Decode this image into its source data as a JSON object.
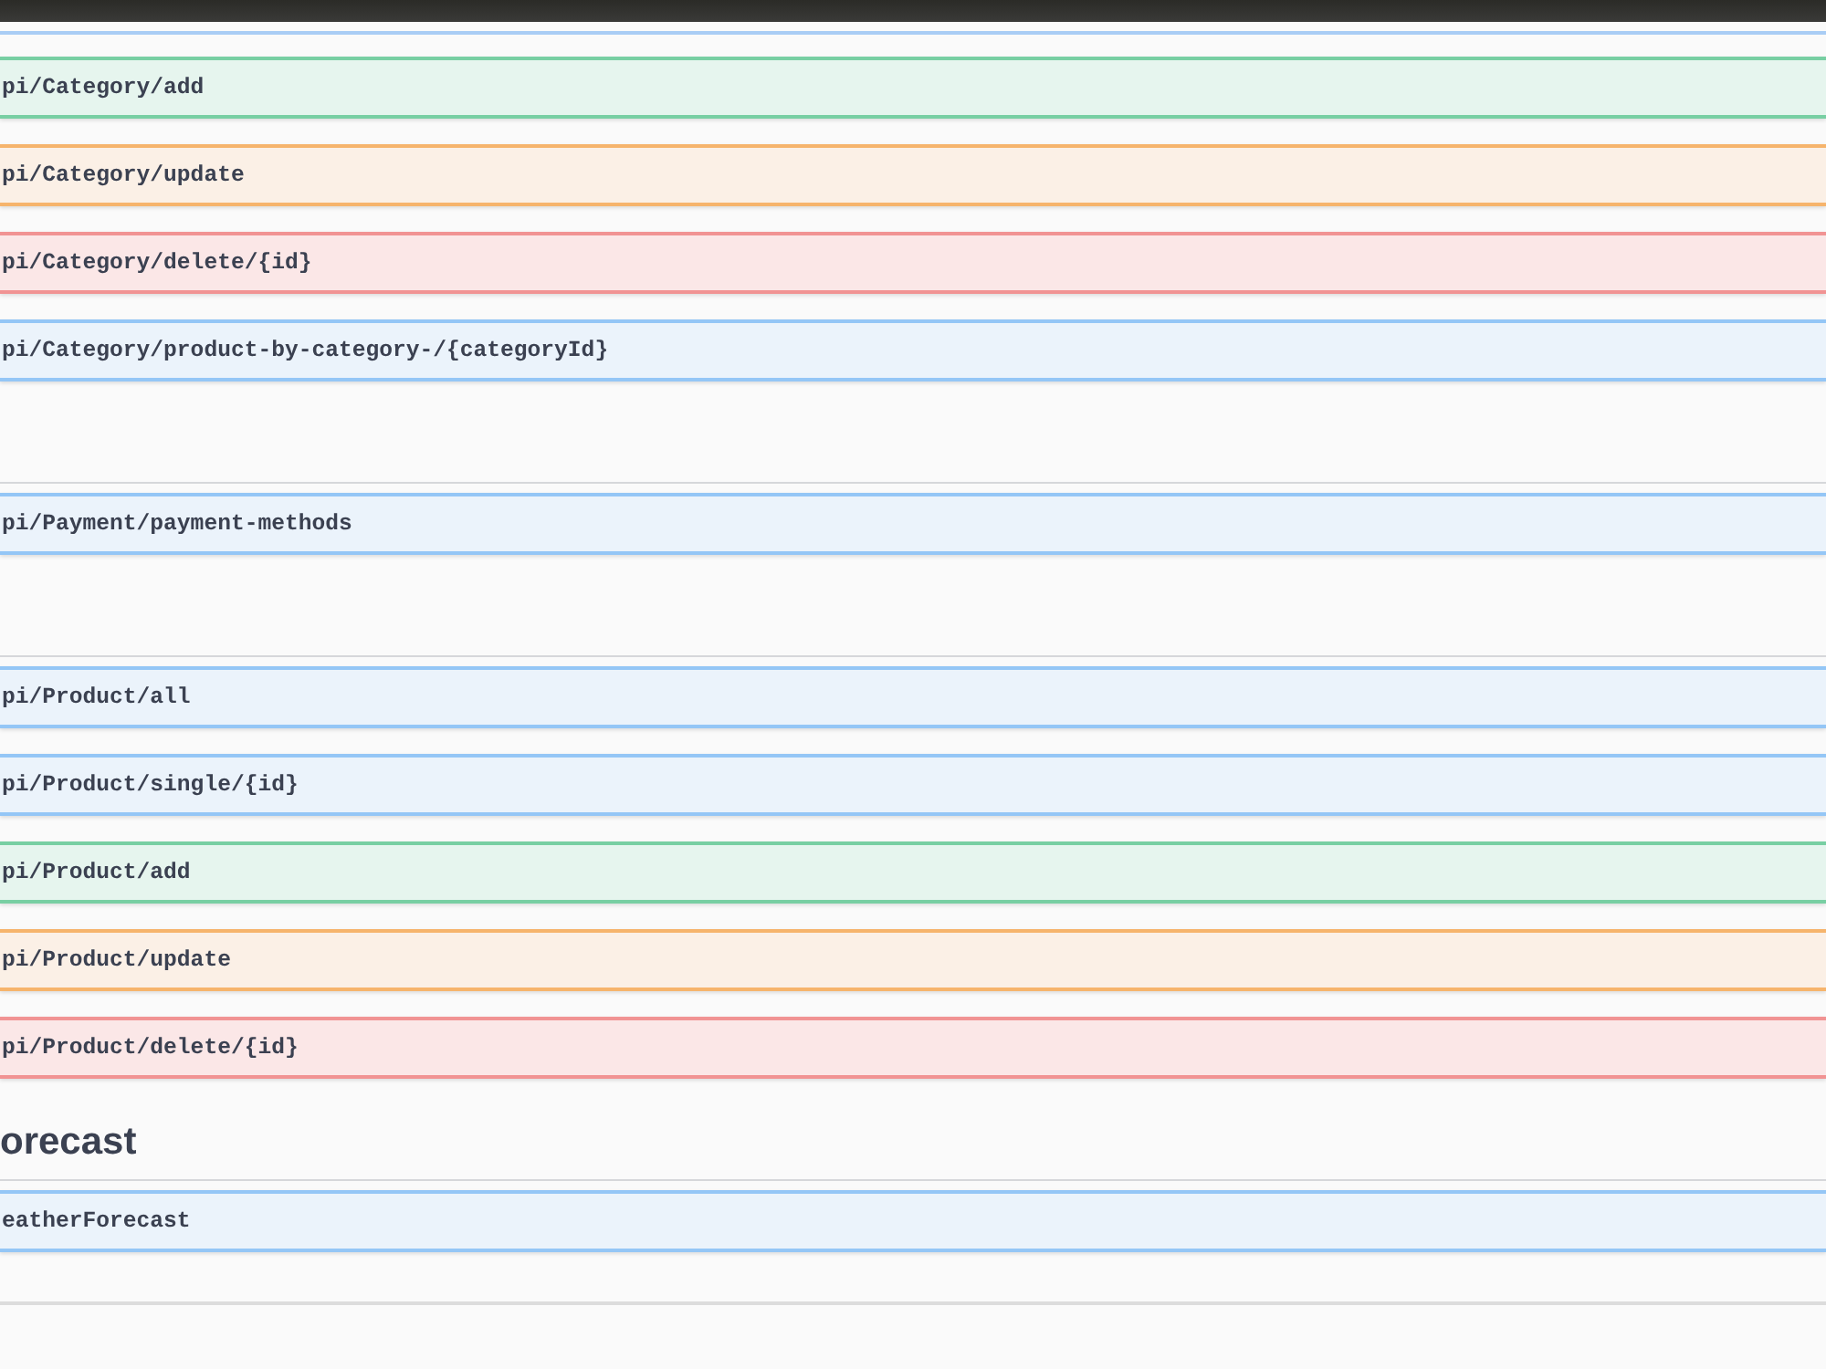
{
  "sections": [
    {
      "operations": [
        {
          "kind": "post",
          "path": "pi/Category/add"
        },
        {
          "kind": "put",
          "path": "pi/Category/update"
        },
        {
          "kind": "delete",
          "path": "pi/Category/delete/{id}"
        },
        {
          "kind": "get",
          "path": "pi/Category/product-by-category-/{categoryId}"
        }
      ]
    },
    {
      "operations": [
        {
          "kind": "get",
          "path": "pi/Payment/payment-methods"
        }
      ]
    },
    {
      "operations": [
        {
          "kind": "get",
          "path": "pi/Product/all"
        },
        {
          "kind": "get",
          "path": "pi/Product/single/{id}"
        },
        {
          "kind": "post",
          "path": "pi/Product/add"
        },
        {
          "kind": "put",
          "path": "pi/Product/update"
        },
        {
          "kind": "delete",
          "path": "pi/Product/delete/{id}"
        }
      ]
    },
    {
      "heading": "orecast",
      "operations": [
        {
          "kind": "get",
          "path": "eatherForecast"
        }
      ]
    }
  ]
}
